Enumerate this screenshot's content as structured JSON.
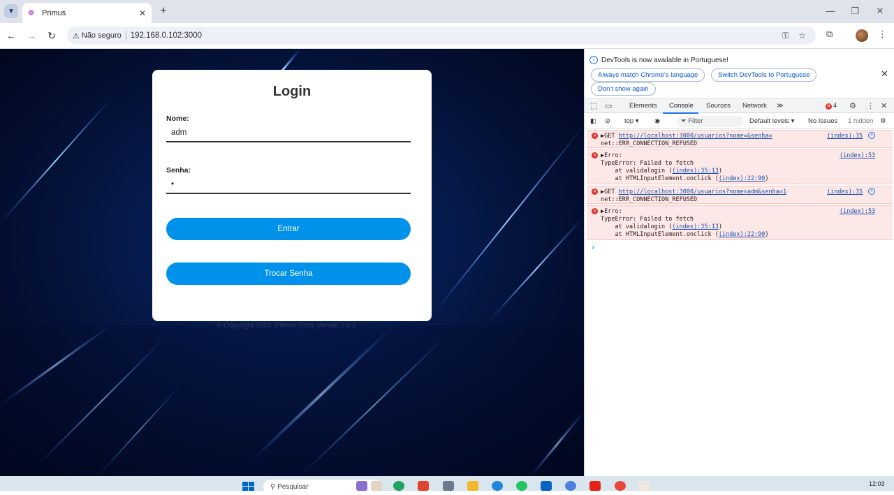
{
  "browser": {
    "tab_title": "Primus",
    "tab_close": "✕",
    "new_tab": "+",
    "security_label": "Não seguro",
    "url": "192.168.0.102:3000",
    "window_controls": [
      "—",
      "❐",
      "✕"
    ]
  },
  "login": {
    "title": "Login",
    "name_label": "Nome:",
    "name_value": "adm",
    "password_label": "Senha:",
    "password_value": "1",
    "submit_label": "Entrar",
    "change_password_label": "Trocar Senha",
    "footer": "© Copyright 2024. Primus Tech| Versão 2.0.0"
  },
  "devtools": {
    "banner_text": "DevTools is now available in Portuguese!",
    "banner_buttons": [
      "Always match Chrome's language",
      "Switch DevTools to Portuguese",
      "Don't show again"
    ],
    "tabs": [
      "Elements",
      "Console",
      "Sources",
      "Network"
    ],
    "more_tabs": "≫",
    "error_count": "4",
    "context": "top",
    "filter_placeholder": "Filter",
    "levels": "Default levels",
    "issues": "No Issues",
    "hidden": "1 hidden",
    "messages": [
      {
        "prefix": "▶GET ",
        "url": "http://localhost:3000/usuarios?nome=&senha=",
        "detail": "net::ERR_CONNECTION_REFUSED",
        "source": "(index):35"
      },
      {
        "line1": "▶Erro:",
        "line2": "TypeError: Failed to fetch",
        "line3_prefix": "    at validalogin (",
        "line3_link": "(index):35:13",
        "line3_suffix": ")",
        "line4_prefix": "    at HTMLInputElement.onclick (",
        "line4_link": "(index):22:90",
        "line4_suffix": ")",
        "source": "(index):53"
      },
      {
        "prefix": "▶GET ",
        "url": "http://localhost:3000/usuarios?nome=adm&senha=1",
        "detail": "net::ERR_CONNECTION_REFUSED",
        "source": "(index):35"
      },
      {
        "line1": "▶Erro:",
        "line2": "TypeError: Failed to fetch",
        "line3_prefix": "    at validalogin (",
        "line3_link": "(index):35:13",
        "line3_suffix": ")",
        "line4_prefix": "    at HTMLInputElement.onclick (",
        "line4_link": "(index):22:90",
        "line4_suffix": ")",
        "source": "(index):53"
      }
    ],
    "prompt": "›"
  },
  "taskbar": {
    "search_placeholder": "Pesquisar",
    "clock": "12:03"
  },
  "colors": {
    "button_blue": "#0091ea",
    "error_bg": "#fce8e6",
    "accent": "#1a73e8"
  }
}
